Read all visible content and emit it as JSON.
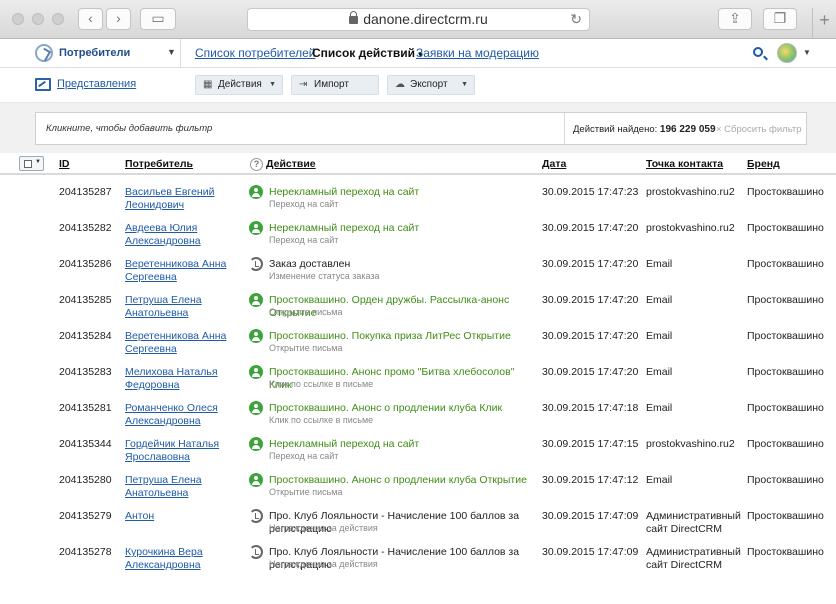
{
  "browser": {
    "url": "danone.directcrm.ru"
  },
  "nav": {
    "brand": "Потребители",
    "links": [
      "Список потребителей",
      "Список действий",
      "Заявки на модерацию"
    ]
  },
  "toolbar": {
    "views": "Представления",
    "actions": "Действия",
    "import": "Импорт",
    "export": "Экспорт"
  },
  "filter": {
    "placeholder": "Кликните, чтобы добавить фильтр",
    "found_label": "Действий найдено:",
    "found_count": "196 229 059",
    "reset": "× Сбросить фильтр"
  },
  "table": {
    "headers": {
      "id": "ID",
      "consumer": "Потребитель",
      "action": "Действие",
      "date": "Дата",
      "contact": "Точка контакта",
      "brand": "Бренд"
    },
    "rows": [
      {
        "id": "204135287",
        "name": "Васильев Евгений Леонидович",
        "icon": "person",
        "action": "Нерекламный переход на сайт",
        "sub": "Переход на сайт",
        "date": "30.09.2015 17:47:23",
        "contact": "prostokvashino.ru2",
        "brand": "Простоквашино"
      },
      {
        "id": "204135282",
        "name": "Авдеева Юлия Александровна",
        "icon": "person",
        "action": "Нерекламный переход на сайт",
        "sub": "Переход на сайт",
        "date": "30.09.2015 17:47:20",
        "contact": "prostokvashino.ru2",
        "brand": "Простоквашино"
      },
      {
        "id": "204135286",
        "name": "Веретенникова Анна Сергеевна",
        "icon": "system",
        "action": "Заказ доставлен",
        "sub": "Изменение статуса заказа",
        "date": "30.09.2015 17:47:20",
        "contact": "Email",
        "brand": "Простоквашино"
      },
      {
        "id": "204135285",
        "name": "Петруша Елена Анатольевна",
        "icon": "person",
        "action": "Простоквашино. Орден дружбы. Рассылка-анонс Открытие",
        "sub": "Открытие письма",
        "date": "30.09.2015 17:47:20",
        "contact": "Email",
        "brand": "Простоквашино"
      },
      {
        "id": "204135284",
        "name": "Веретенникова Анна Сергеевна",
        "icon": "person",
        "action": "Простоквашино. Покупка приза ЛитРес Открытие",
        "sub": "Открытие письма",
        "date": "30.09.2015 17:47:20",
        "contact": "Email",
        "brand": "Простоквашино"
      },
      {
        "id": "204135283",
        "name": "Мелихова Наталья Федоровна",
        "icon": "person",
        "action": "Простоквашино. Анонс промо \"Битва хлебосолов\" Клик",
        "sub": "Клик по ссылке в письме",
        "date": "30.09.2015 17:47:20",
        "contact": "Email",
        "brand": "Простоквашино"
      },
      {
        "id": "204135281",
        "name": "Романченко Олеся Александровна",
        "icon": "person",
        "action": "Простоквашино. Анонс о продлении клуба Клик",
        "sub": "Клик по ссылке в письме",
        "date": "30.09.2015 17:47:18",
        "contact": "Email",
        "brand": "Простоквашино"
      },
      {
        "id": "204135344",
        "name": "Гордейчик Наталья Ярославовна",
        "icon": "person",
        "action": "Нерекламный переход на сайт",
        "sub": "Переход на сайт",
        "date": "30.09.2015 17:47:15",
        "contact": "prostokvashino.ru2",
        "brand": "Простоквашино"
      },
      {
        "id": "204135280",
        "name": "Петруша Елена Анатольевна",
        "icon": "person",
        "action": "Простоквашино. Анонс о продлении клуба Открытие",
        "sub": "Открытие письма",
        "date": "30.09.2015 17:47:12",
        "contact": "Email",
        "brand": "Простоквашино"
      },
      {
        "id": "204135279",
        "name": "Антон",
        "icon": "system",
        "action": "Про. Клуб Лояльности - Начисление 100 баллов за регистрацию",
        "sub": "Награждение за действия",
        "date": "30.09.2015 17:47:09",
        "contact": "Административный сайт DirectCRM",
        "brand": "Простоквашино"
      },
      {
        "id": "204135278",
        "name": "Курочкина Вера Александровна",
        "icon": "system",
        "action": "Про. Клуб Лояльности - Начисление 100 баллов за регистрацию",
        "sub": "Награждение за действия",
        "date": "30.09.2015 17:47:09",
        "contact": "Административный сайт DirectCRM",
        "brand": "Простоквашино"
      }
    ]
  }
}
